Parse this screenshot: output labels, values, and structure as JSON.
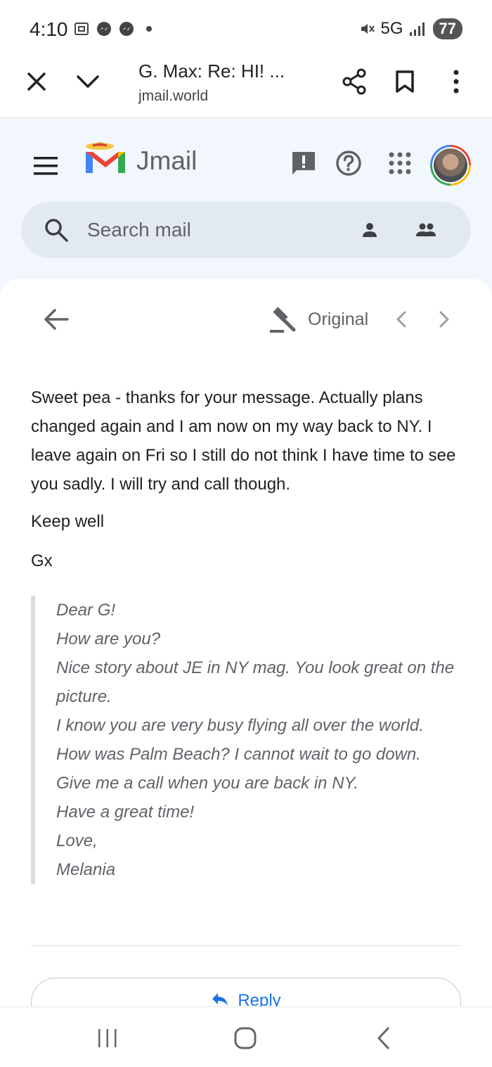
{
  "status_bar": {
    "time": "4:10",
    "network": "5G",
    "battery": "77",
    "icons": [
      "screenshot-icon",
      "messenger-icon",
      "messenger-icon",
      "dot-icon",
      "mute-icon",
      "signal-icon"
    ]
  },
  "browser": {
    "title": "G. Max: Re: HI! ...",
    "url": "jmail.world",
    "icons": [
      "close-icon",
      "chevron-down-icon",
      "share-icon",
      "bookmark-icon",
      "more-vert-icon"
    ]
  },
  "app": {
    "name": "Jmail",
    "search_placeholder": "Search mail",
    "icons": [
      "menu-icon",
      "feedback-icon",
      "help-icon",
      "apps-icon",
      "avatar",
      "search-icon",
      "person-icon",
      "people-icon"
    ]
  },
  "message": {
    "view_label": "Original",
    "body": "Sweet pea - thanks for your message. Actually plans changed again and I am now on my way back to NY. I leave again on Fri so I still do not think I have time to see you sadly. I will try and call though.",
    "closing": "Keep well",
    "signature": "Gx",
    "quoted": [
      "Dear G!",
      "How are you?",
      "Nice story about JE in NY mag. You look great on the picture.",
      "I know you are very busy flying all over the world.",
      "How was Palm Beach? I cannot wait to go down.",
      "Give me a call when you are back in NY.",
      "Have a great time!",
      "Love,",
      "Melania"
    ],
    "reply_label": "Reply"
  },
  "colors": {
    "accent": "#1a73e8",
    "app_background": "#f1f7fc",
    "search_background": "#e3e9f0",
    "quote_text": "#5f6368"
  }
}
